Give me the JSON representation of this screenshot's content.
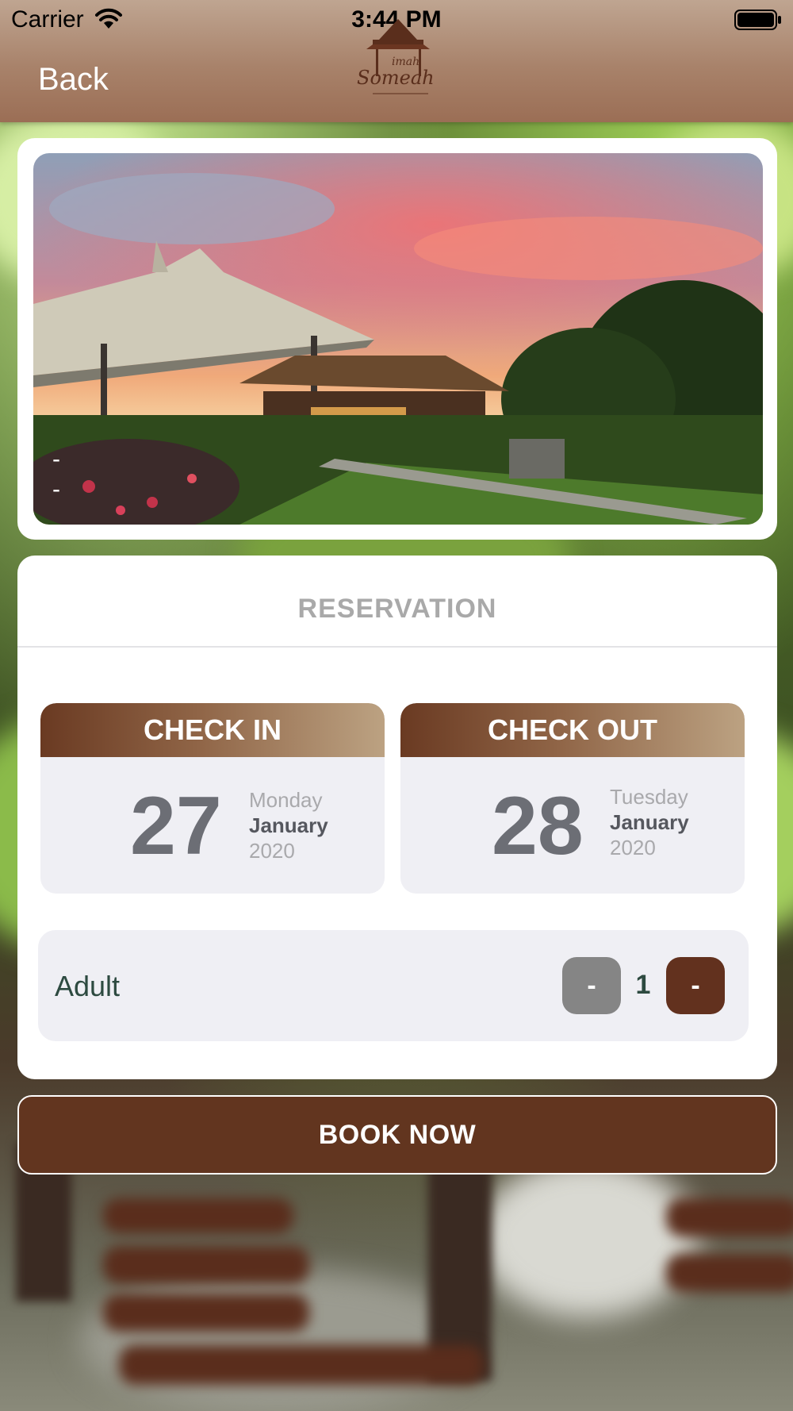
{
  "status_bar": {
    "carrier": "Carrier",
    "time": "3:44 PM"
  },
  "nav": {
    "back_label": "Back",
    "logo_text_top": "imah",
    "logo_text_bottom": "Someah"
  },
  "gallery": {
    "pager_dots": [
      "-",
      "-"
    ]
  },
  "reservation": {
    "title": "RESERVATION",
    "check_in": {
      "label": "CHECK IN",
      "day": "27",
      "weekday": "Monday",
      "month": "January",
      "year": "2020"
    },
    "check_out": {
      "label": "CHECK OUT",
      "day": "28",
      "weekday": "Tuesday",
      "month": "January",
      "year": "2020"
    },
    "adult": {
      "label": "Adult",
      "decrement_label": "-",
      "count": "1",
      "increment_label": "-"
    }
  },
  "book_button_label": "BOOK NOW",
  "colors": {
    "brand_brown": "#62311e",
    "nav_tan": "#a8826a",
    "card_bg": "#ffffff",
    "panel_bg": "#efeff4",
    "stepper_gray": "#858585",
    "adult_text": "#2d4a40"
  },
  "icons": [
    "wifi-icon",
    "battery-icon",
    "logo-pavilion-icon"
  ]
}
